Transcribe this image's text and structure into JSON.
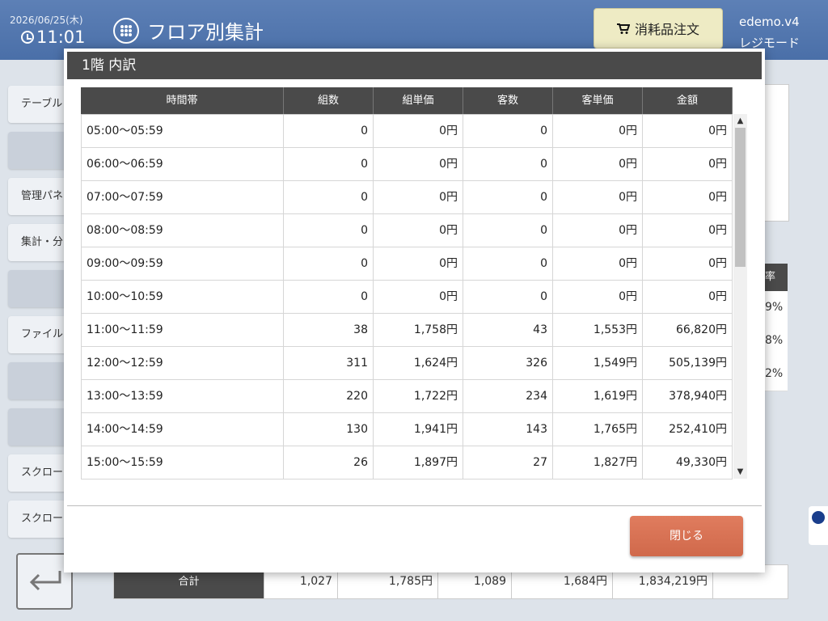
{
  "header": {
    "date": "2026/06/25(木)",
    "time": "11:01",
    "title": "フロア別集計",
    "order_button": "消耗品注文",
    "user": "edemo.v4",
    "mode": "レジモード"
  },
  "side_menu": {
    "items": [
      "テーブル",
      "",
      "管理パネ",
      "集計・分",
      "",
      "ファイル",
      "",
      "",
      "スクロー",
      "スクロー"
    ]
  },
  "background_table": {
    "header_fragment": "率",
    "rows": [
      "9%",
      "8%",
      "2%"
    ],
    "totals": {
      "label": "合計",
      "groups": "1,027",
      "group_price": "1,785円",
      "customers": "1,089",
      "customer_price": "1,684円",
      "amount": "1,834,219円"
    }
  },
  "modal": {
    "title": "1階 内訳",
    "columns": [
      "時間帯",
      "組数",
      "組単価",
      "客数",
      "客単価",
      "金額"
    ],
    "rows": [
      {
        "time": "05:00～05:59",
        "groups": "0",
        "group_price": "0円",
        "customers": "0",
        "customer_price": "0円",
        "amount": "0円"
      },
      {
        "time": "06:00～06:59",
        "groups": "0",
        "group_price": "0円",
        "customers": "0",
        "customer_price": "0円",
        "amount": "0円"
      },
      {
        "time": "07:00～07:59",
        "groups": "0",
        "group_price": "0円",
        "customers": "0",
        "customer_price": "0円",
        "amount": "0円"
      },
      {
        "time": "08:00～08:59",
        "groups": "0",
        "group_price": "0円",
        "customers": "0",
        "customer_price": "0円",
        "amount": "0円"
      },
      {
        "time": "09:00～09:59",
        "groups": "0",
        "group_price": "0円",
        "customers": "0",
        "customer_price": "0円",
        "amount": "0円"
      },
      {
        "time": "10:00～10:59",
        "groups": "0",
        "group_price": "0円",
        "customers": "0",
        "customer_price": "0円",
        "amount": "0円"
      },
      {
        "time": "11:00～11:59",
        "groups": "38",
        "group_price": "1,758円",
        "customers": "43",
        "customer_price": "1,553円",
        "amount": "66,820円"
      },
      {
        "time": "12:00～12:59",
        "groups": "311",
        "group_price": "1,624円",
        "customers": "326",
        "customer_price": "1,549円",
        "amount": "505,139円"
      },
      {
        "time": "13:00～13:59",
        "groups": "220",
        "group_price": "1,722円",
        "customers": "234",
        "customer_price": "1,619円",
        "amount": "378,940円"
      },
      {
        "time": "14:00～14:59",
        "groups": "130",
        "group_price": "1,941円",
        "customers": "143",
        "customer_price": "1,765円",
        "amount": "252,410円"
      },
      {
        "time": "15:00～15:59",
        "groups": "26",
        "group_price": "1,897円",
        "customers": "27",
        "customer_price": "1,827円",
        "amount": "49,330円"
      }
    ],
    "close_button": "閉じる"
  },
  "icons": {
    "clock": "clock-icon",
    "menu": "grid-menu-icon",
    "cart": "cart-icon",
    "back": "back-arrow-icon"
  }
}
